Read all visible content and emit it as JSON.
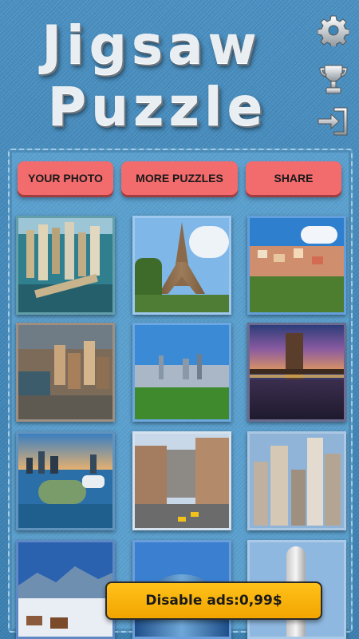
{
  "header": {
    "title_line1": "Jigsaw",
    "title_line2": "Puzzle"
  },
  "icons": {
    "settings": "gear-icon",
    "leaderboard": "trophy-icon",
    "exit": "exit-door-icon"
  },
  "actions": {
    "your_photo": "YOUR PHOTO",
    "more_puzzles": "MORE PUZZLES",
    "share": "SHARE"
  },
  "puzzles": [
    {
      "id": "dubai-marina"
    },
    {
      "id": "eiffel-tower"
    },
    {
      "id": "coastal-village"
    },
    {
      "id": "city-harbor-aerial"
    },
    {
      "id": "city-skyline-park"
    },
    {
      "id": "bridge-at-dusk"
    },
    {
      "id": "waterfront-city"
    },
    {
      "id": "city-street"
    },
    {
      "id": "skyscrapers"
    },
    {
      "id": "snowy-village"
    },
    {
      "id": "glass-tower"
    },
    {
      "id": "tall-tower"
    }
  ],
  "ad": {
    "label": "Disable ads:0,99$"
  },
  "colors": {
    "background": "#3f86b6",
    "button": "#f26b6d",
    "ad_banner": "#ffb80d"
  }
}
